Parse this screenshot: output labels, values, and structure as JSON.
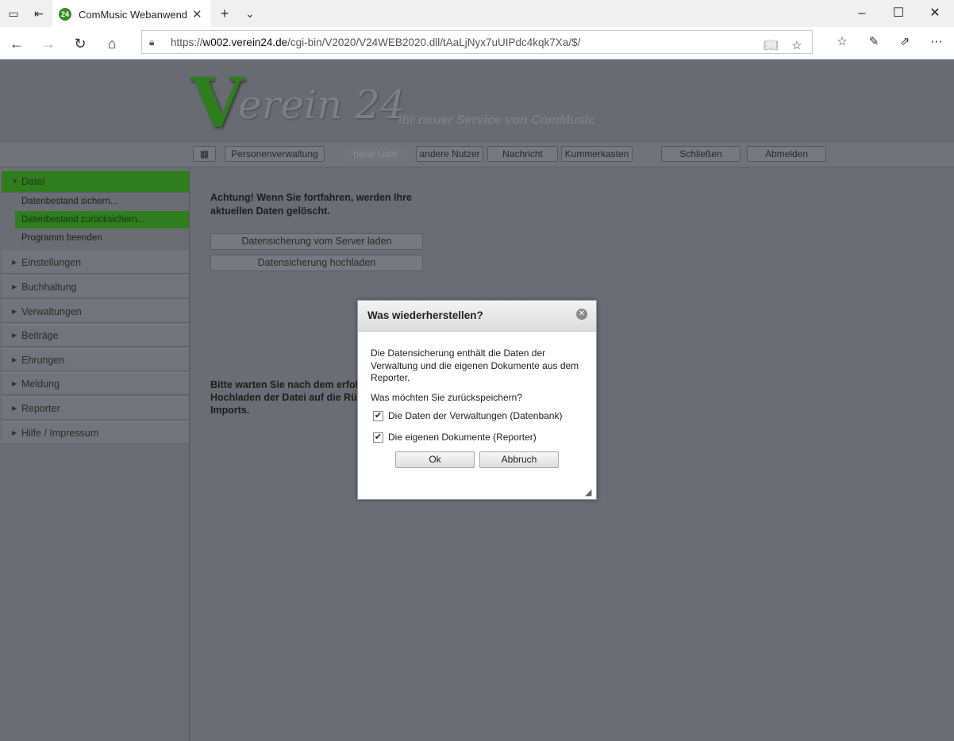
{
  "browser": {
    "tab_title": "ComMusic Webanwend",
    "tab_favicon": "24",
    "url_prefix": "https://",
    "url_host": "w002.verein24.de",
    "url_path": "/cgi-bin/V2020/V24WEB2020.dll/tAaLjNyx7uUIPdc4kqk7Xa/$/"
  },
  "header": {
    "logo_v": "V",
    "logo_rest": "erein 24",
    "tagline": "Ihr neuer Service von ComMusic"
  },
  "toolbar": {
    "menu_icon": "menu-icon",
    "personenverwaltung": "Personenverwaltung",
    "neue_liste": "neue Liste",
    "andere_nutzer": "andere Nutzer",
    "nachricht": "Nachricht",
    "kummerkasten": "Kummerkasten",
    "schliessen": "Schließen",
    "abmelden": "Abmelden"
  },
  "sidebar": {
    "datei": "Datei",
    "datei_items": [
      "Datenbestand sichern...",
      "Datenbestand zurücksichern...",
      "Programm beenden"
    ],
    "sections": [
      "Einstellungen",
      "Buchhaltung",
      "Verwaltungen",
      "Beiträge",
      "Ehrungen",
      "Meldung",
      "Reporter",
      "Hilfe / Impressum"
    ]
  },
  "content": {
    "warning": "Achtung! Wenn Sie fortfahren, werden Ihre aktuellen Daten gelöscht.",
    "btn_server": "Datensicherung vom Server laden",
    "btn_upload": "Datensicherung hochladen",
    "wait_line1": "Bitte warten Sie nach dem erfolg",
    "wait_line2": "Hochladen der Datei auf die Rück",
    "wait_line3": "Imports."
  },
  "dialog": {
    "title": "Was wiederherstellen?",
    "body": "Die Datensicherung enthält die Daten der Verwaltung und die eigenen Dokumente aus dem Reporter.",
    "question": "Was möchten Sie zurückspeichern?",
    "check1_label": "Die Daten der Verwaltungen (Datenbank)",
    "check1_checked": true,
    "check2_label": "Die eigenen Dokumente (Reporter)",
    "check2_checked": true,
    "ok": "Ok",
    "cancel": "Abbruch"
  },
  "colors": {
    "brand_green": "#2f7d1f",
    "overlay_gray": "#6a6d73"
  }
}
